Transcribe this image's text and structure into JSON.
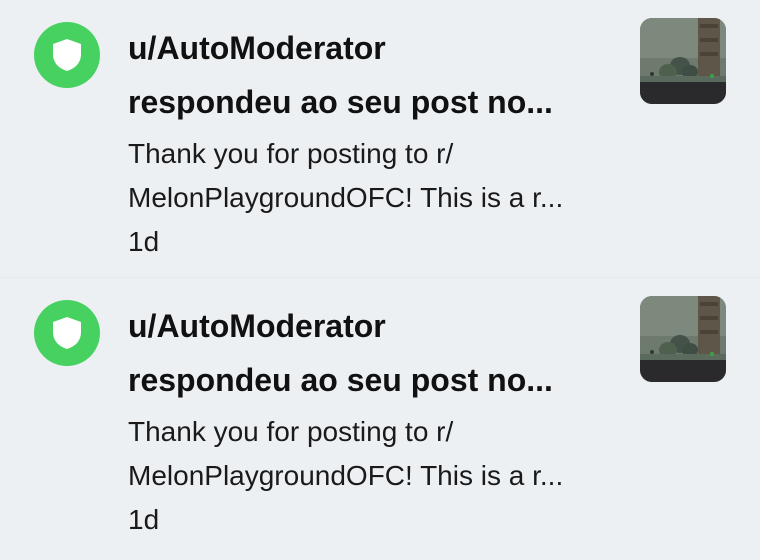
{
  "colors": {
    "background": "#edf0f3",
    "moderator_avatar": "#46d160",
    "text": "#111111"
  },
  "notifications": [
    {
      "avatar_icon": "shield-icon",
      "username": "u/AutoModerator",
      "action": "respondeu ao seu post no...",
      "preview_line1": "Thank you for posting to r/",
      "preview_line2": "MelonPlaygroundOFC! This is a r...",
      "time": "1d",
      "thumbnail": "post-thumbnail"
    },
    {
      "avatar_icon": "shield-icon",
      "username": "u/AutoModerator",
      "action": "respondeu ao seu post no...",
      "preview_line1": "Thank you for posting to r/",
      "preview_line2": "MelonPlaygroundOFC! This is a r...",
      "time": "1d",
      "thumbnail": "post-thumbnail"
    }
  ]
}
